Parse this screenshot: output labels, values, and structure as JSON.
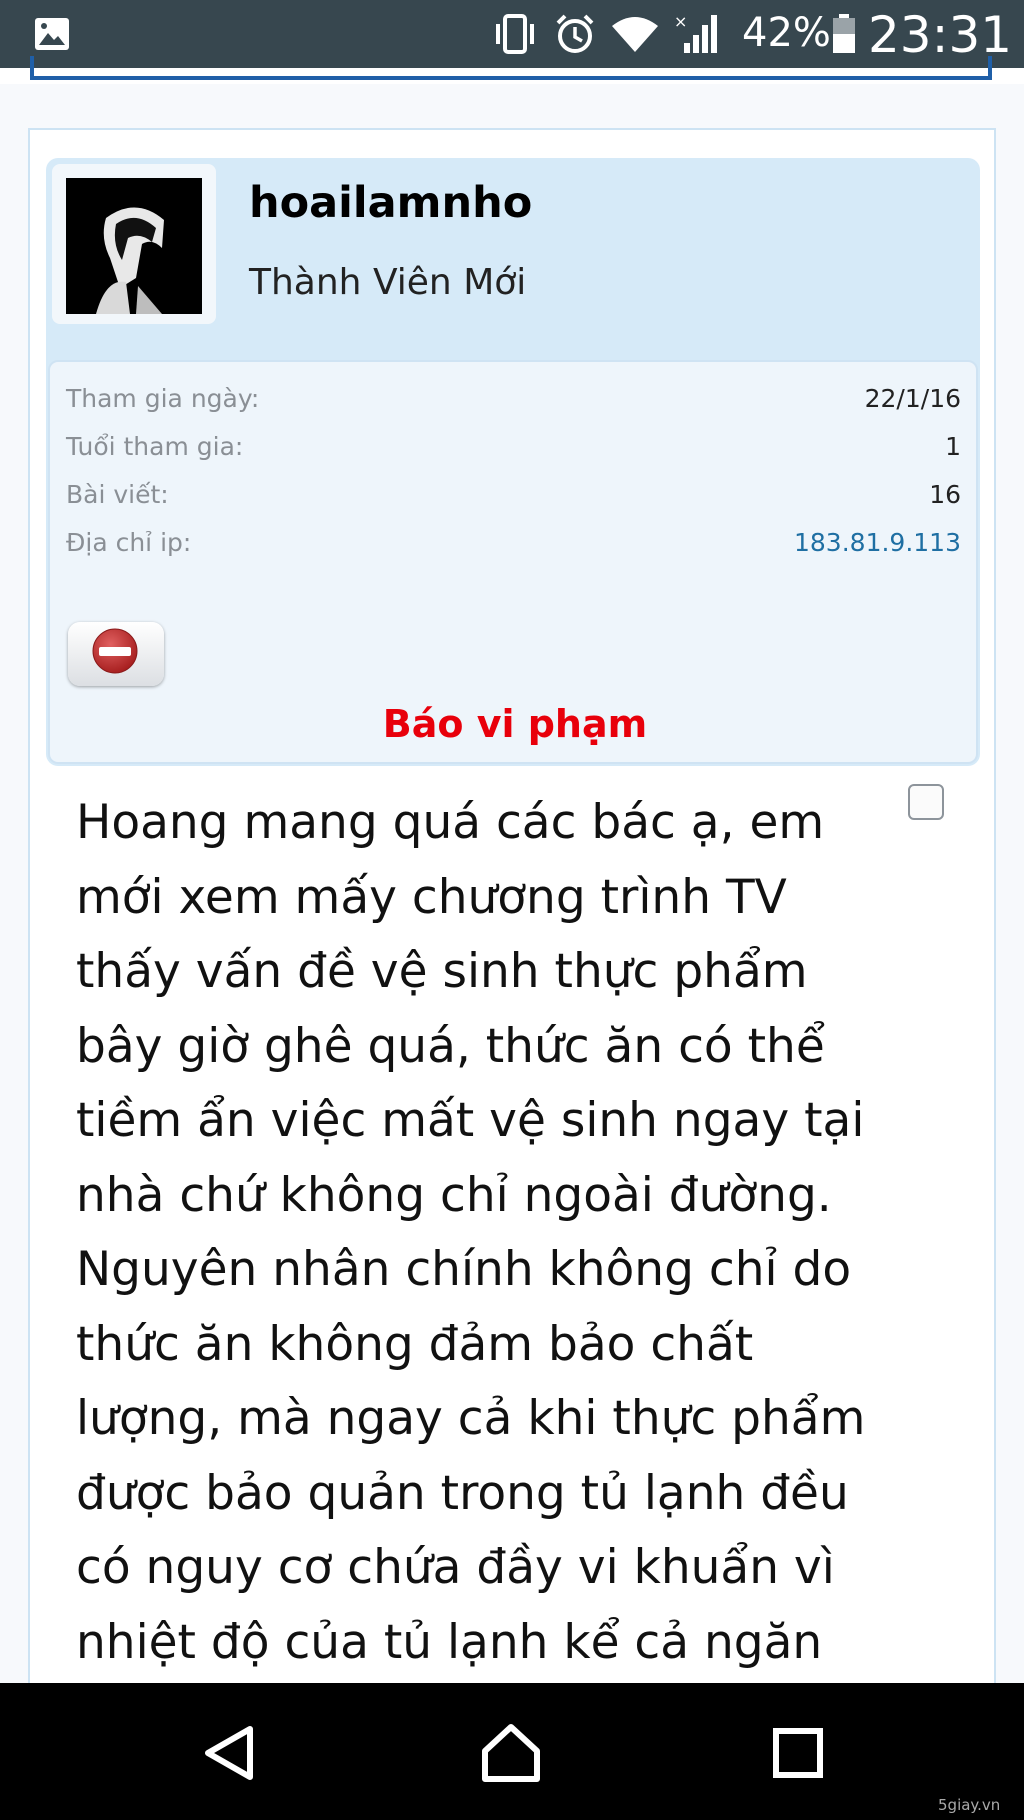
{
  "status_bar": {
    "battery_percent": "42%",
    "time": "23:31",
    "icons": [
      "gallery-icon",
      "vibrate-icon",
      "alarm-icon",
      "wifi-icon",
      "signal-icon",
      "battery-icon"
    ]
  },
  "user": {
    "username": "hoailamnho",
    "title": "Thành Viên Mới",
    "stats": [
      {
        "label": "Tham gia ngày:",
        "value": "22/1/16"
      },
      {
        "label": "Tuổi tham gia:",
        "value": "1"
      },
      {
        "label": "Bài viết:",
        "value": "16"
      },
      {
        "label": "Địa chỉ ip:",
        "value": "183.81.9.113"
      }
    ],
    "report_label": "Báo vi phạm"
  },
  "post": {
    "message": "Hoang mang quá các bác ạ, em mới xem mấy chương trình TV thấy vấn đề vệ sinh thực phẩm bây giờ ghê quá, thức ăn có thể tiềm ẩn việc mất vệ sinh ngay tại nhà chứ không chỉ ngoài đường. Nguyên nhân chính không chỉ do thức ăn không đảm bảo chất lượng, mà ngay cả khi thực phẩm được bảo quản trong tủ lạnh đều có nguy cơ chứa đầy vi khuẩn vì nhiệt độ của tủ lạnh kể cả ngăn"
  },
  "nav": {
    "icons": [
      "back-icon",
      "home-icon",
      "recents-icon"
    ]
  },
  "watermark": "5giay.vn",
  "colors": {
    "status_bar": "#37474f",
    "userbox": "#d6eaf8",
    "report": "#e8000b",
    "ip_link": "#1f6fa3"
  }
}
